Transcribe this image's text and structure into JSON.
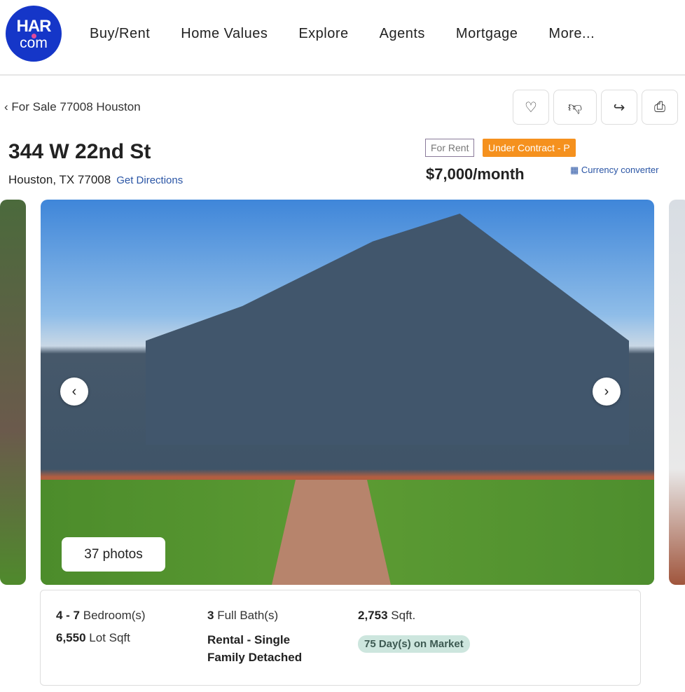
{
  "header": {
    "logo_top": "HAR",
    "logo_bottom": "com",
    "nav": [
      "Buy/Rent",
      "Home Values",
      "Explore",
      "Agents",
      "Mortgage",
      "More..."
    ]
  },
  "breadcrumb": {
    "back_label": "For Sale 77008 Houston"
  },
  "actions": {
    "icons": [
      "heart-icon",
      "thumbs-down-icon",
      "share-icon",
      "print-icon"
    ]
  },
  "listing": {
    "address": "344 W 22nd St",
    "city": "Houston, TX 77008",
    "directions": "Get Directions",
    "badge_type": "For Rent",
    "badge_status": "Under Contract - P",
    "price": "$7,000/month",
    "currency": "Currency converter",
    "status_color": "#f5911e"
  },
  "gallery": {
    "photo_count": "37 photos"
  },
  "facts": {
    "bed_val": "4 - 7",
    "bed_label": "Bedroom(s)",
    "bath_val": "3",
    "bath_label": "Full Bath(s)",
    "sqft_val": "2,753",
    "sqft_label": "Sqft.",
    "lot_val": "6,550",
    "lot_label": "Lot Sqft",
    "type_line1": "Rental - Single",
    "type_line2": "Family Detached",
    "days_on_market": "75 Day(s) on Market"
  }
}
